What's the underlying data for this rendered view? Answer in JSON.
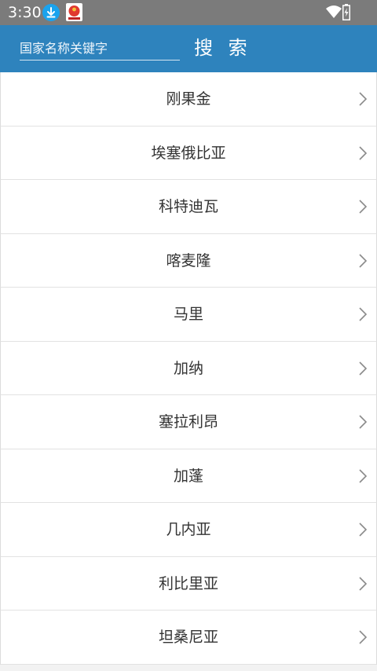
{
  "status_bar": {
    "time": "3:30",
    "icons": [
      "download-icon",
      "app-notification-icon",
      "wifi-icon",
      "battery-charging-icon"
    ]
  },
  "header": {
    "search_placeholder": "国家名称关键字",
    "search_value": "",
    "search_button_label": "搜 索",
    "background_color": "#2e83bd"
  },
  "countries": [
    {
      "name": "刚果金"
    },
    {
      "name": "埃塞俄比亚"
    },
    {
      "name": "科特迪瓦"
    },
    {
      "name": "喀麦隆"
    },
    {
      "name": "马里"
    },
    {
      "name": "加纳"
    },
    {
      "name": "塞拉利昂"
    },
    {
      "name": "加蓬"
    },
    {
      "name": "几内亚"
    },
    {
      "name": "利比里亚"
    },
    {
      "name": "坦桑尼亚"
    }
  ]
}
